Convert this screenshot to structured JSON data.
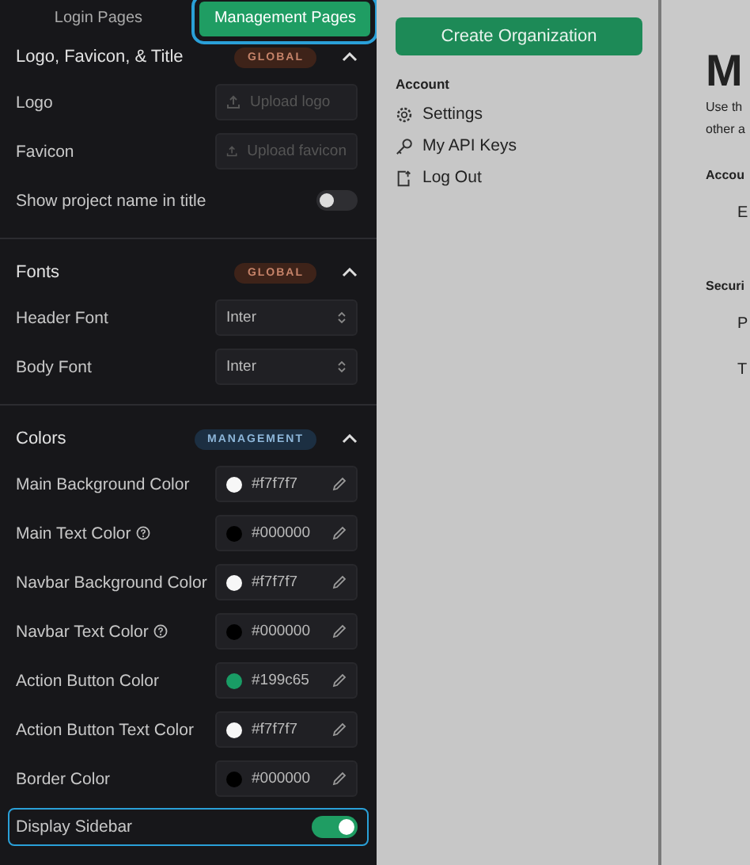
{
  "tabs": [
    {
      "label": "Login Pages",
      "selected": false
    },
    {
      "label": "Management Pages",
      "selected": true
    }
  ],
  "sections": [
    {
      "title": "Logo, Favicon, & Title",
      "badge": "GLOBAL",
      "kind": "global",
      "expanded": true,
      "rows": [
        {
          "kind": "upload",
          "label": "Logo",
          "placeholder": "Upload logo"
        },
        {
          "kind": "upload",
          "label": "Favicon",
          "placeholder": "Upload favicon"
        },
        {
          "kind": "toggle",
          "label": "Show project name in title",
          "on": false,
          "focused": false
        }
      ]
    },
    {
      "title": "Fonts",
      "badge": "GLOBAL",
      "kind": "global",
      "expanded": true,
      "rows": [
        {
          "kind": "select",
          "label": "Header Font",
          "value": "Inter"
        },
        {
          "kind": "select",
          "label": "Body Font",
          "value": "Inter"
        }
      ]
    },
    {
      "title": "Colors",
      "badge": "MANAGEMENT",
      "kind": "management",
      "expanded": true,
      "rows": [
        {
          "kind": "color",
          "label": "Main Background Color",
          "help": false,
          "value": "#f7f7f7",
          "color": "#f7f7f7"
        },
        {
          "kind": "color",
          "label": "Main Text Color",
          "help": true,
          "value": "#000000",
          "color": "#000000"
        },
        {
          "kind": "color",
          "label": "Navbar Background Color",
          "help": false,
          "value": "#f7f7f7",
          "color": "#f7f7f7"
        },
        {
          "kind": "color",
          "label": "Navbar Text Color",
          "help": true,
          "value": "#000000",
          "color": "#000000"
        },
        {
          "kind": "color",
          "label": "Action Button Color",
          "help": false,
          "value": "#199c65",
          "color": "#199c65"
        },
        {
          "kind": "color",
          "label": "Action Button Text Color",
          "help": false,
          "value": "#f7f7f7",
          "color": "#f7f7f7"
        },
        {
          "kind": "color",
          "label": "Border Color",
          "help": false,
          "value": "#000000",
          "color": "#000000"
        },
        {
          "kind": "toggle",
          "label": "Display Sidebar",
          "on": true,
          "focused": true
        }
      ]
    }
  ],
  "preview": {
    "sidebar": {
      "button": "Create Organization",
      "heading": "Account",
      "items": [
        {
          "label": "Settings"
        },
        {
          "label": "My API Keys"
        },
        {
          "label": "Log Out"
        }
      ]
    },
    "main": {
      "title": "M",
      "description": [
        "Use th",
        "other a"
      ],
      "sections": [
        {
          "heading": "Accou",
          "items": [
            "E"
          ]
        },
        {
          "heading": "Securi",
          "items": [
            "P",
            "T"
          ]
        }
      ]
    }
  }
}
